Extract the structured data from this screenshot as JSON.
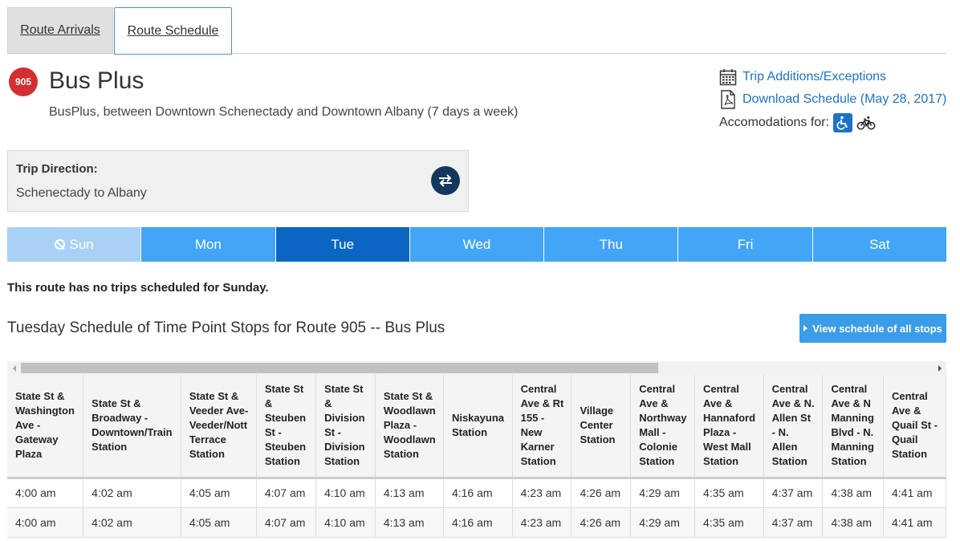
{
  "tabs": {
    "arrivals": "Route Arrivals",
    "schedule": "Route Schedule"
  },
  "route": {
    "number": "905",
    "name": "Bus Plus",
    "description": "BusPlus, between Downtown Schenectady and Downtown Albany (7 days a week)",
    "badge_color": "#d32f2f"
  },
  "links": {
    "trip_additions": "Trip Additions/Exceptions",
    "download": "Download Schedule (May 28, 2017)",
    "accommodations_label": "Accomodations for:"
  },
  "trip_direction": {
    "label": "Trip Direction:",
    "value": "Schenectady to Albany"
  },
  "days": [
    {
      "label": "Sun",
      "state": "disabled"
    },
    {
      "label": "Mon",
      "state": "normal"
    },
    {
      "label": "Tue",
      "state": "active"
    },
    {
      "label": "Wed",
      "state": "normal"
    },
    {
      "label": "Thu",
      "state": "normal"
    },
    {
      "label": "Fri",
      "state": "normal"
    },
    {
      "label": "Sat",
      "state": "normal"
    }
  ],
  "no_trips_msg": "This route has no trips scheduled for Sunday.",
  "schedule_title": "Tuesday Schedule of Time Point Stops for Route 905 -- Bus Plus",
  "view_all_label": "View schedule of all stops",
  "table": {
    "headers": [
      "State St & Washington Ave - Gateway Plaza",
      "State St & Broadway - Downtown/Train Station",
      "State St & Veeder Ave- Veeder/Nott Terrace Station",
      "State St & Steuben St - Steuben Station",
      "State St & Division St - Division Station",
      "State St & Woodlawn Plaza - Woodlawn Station",
      "Niskayuna Station",
      "Central Ave & Rt 155 - New Karner Station",
      "Village Center Station",
      "Central Ave & Northway Mall - Colonie Station",
      "Central Ave & Hannaford Plaza - West Mall Station",
      "Central Ave & N. Allen St - N. Allen Station",
      "Central Ave & N Manning Blvd - N. Manning Station",
      "Central Ave & Quail St - Quail Station"
    ],
    "rows": [
      [
        "4:00 am",
        "4:02 am",
        "4:05 am",
        "4:07 am",
        "4:10 am",
        "4:13 am",
        "4:16 am",
        "4:23 am",
        "4:26 am",
        "4:29 am",
        "4:35 am",
        "4:37 am",
        "4:38 am",
        "4:41 am"
      ],
      [
        "4:00 am",
        "4:02 am",
        "4:05 am",
        "4:07 am",
        "4:10 am",
        "4:13 am",
        "4:16 am",
        "4:23 am",
        "4:26 am",
        "4:29 am",
        "4:35 am",
        "4:37 am",
        "4:38 am",
        "4:41 am"
      ]
    ]
  }
}
